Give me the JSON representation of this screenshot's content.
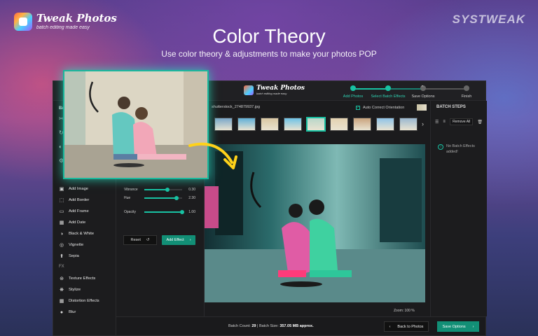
{
  "header": {
    "logo_name": "Tweak Photos",
    "logo_tagline": "batch editing made easy",
    "brand": "SYSTWEAK",
    "title": "Color Theory",
    "subtitle": "Use color theory & adjustments to make your photos POP"
  },
  "app": {
    "logo_name": "Tweak Photos",
    "logo_tagline": "batch editing made easy",
    "steps": [
      {
        "label": "Add Photos",
        "done": true
      },
      {
        "label": "Select Batch Effects",
        "done": true
      },
      {
        "label": "Save Options",
        "done": false
      },
      {
        "label": "Finish",
        "done": false
      }
    ],
    "accent": "#18c2a3"
  },
  "sidebar": {
    "heading": "BATCH",
    "items": [
      {
        "label": "Add Image",
        "icon": "image-icon"
      },
      {
        "label": "Add Border",
        "icon": "border-icon"
      },
      {
        "label": "Add Frame",
        "icon": "frame-icon"
      },
      {
        "label": "Add Date",
        "icon": "calendar-icon"
      },
      {
        "label": "Black & White",
        "icon": "contrast-icon"
      },
      {
        "label": "Vignette",
        "icon": "vignette-icon"
      },
      {
        "label": "Sepia",
        "icon": "sepia-icon"
      }
    ],
    "fx_heading": "FX",
    "fx_items": [
      {
        "label": "Texture Effects",
        "icon": "texture-icon"
      },
      {
        "label": "Stylize",
        "icon": "stylize-icon"
      },
      {
        "label": "Distortion Effects",
        "icon": "distortion-icon"
      },
      {
        "label": "Blur",
        "icon": "blur-icon"
      }
    ]
  },
  "effects": {
    "sliders": [
      {
        "label": "Vibrance",
        "value": "0.30",
        "fraction": 0.62
      },
      {
        "label": "Hue",
        "value": "2.30",
        "fraction": 0.86
      },
      {
        "label": "Opacity",
        "value": "1.00",
        "fraction": 1.0
      }
    ],
    "reset_label": "Reset",
    "add_effect_label": "Add Effect"
  },
  "main": {
    "filename": "shutterstock_274879937.jpg",
    "auto_orientation_label": "Auto Correct Orientation",
    "auto_orientation_checked": true,
    "thumbnail_count": 9,
    "selected_thumbnail": 4,
    "zoom_label": "Zoom: 100 %"
  },
  "batch_panel": {
    "heading": "BATCH STEPS",
    "remove_all_label": "Remove All",
    "empty_message": "No Batch Effects added!"
  },
  "bottom": {
    "batch_count_label": "Batch Count:",
    "batch_count_value": "29",
    "batch_size_label": "Batch Size:",
    "batch_size_value": "357.05 MB approx.",
    "back_label": "Back to Photos",
    "save_label": "Save Options"
  }
}
